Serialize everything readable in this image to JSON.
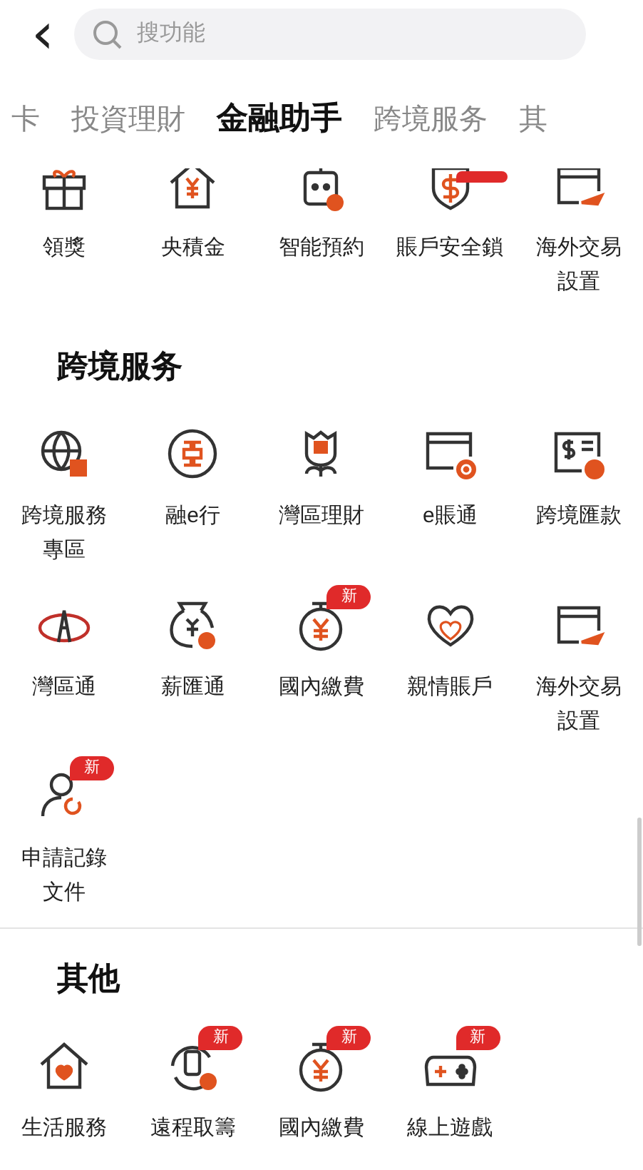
{
  "header": {
    "back": "‹",
    "search": {
      "placeholder": "搜功能"
    }
  },
  "tabs": [
    {
      "label": "卡",
      "selected": false
    },
    {
      "label": "投資理財",
      "selected": false
    },
    {
      "label": "金融助手",
      "selected": true
    },
    {
      "label": "跨境服务",
      "selected": false
    },
    {
      "label": "其",
      "selected": false
    }
  ],
  "sections": [
    {
      "items": [
        {
          "kind": "gift",
          "label": "領獎"
        },
        {
          "kind": "house-yen",
          "label": "央積金"
        },
        {
          "kind": "robot",
          "label": "智能預約"
        },
        {
          "kind": "shield",
          "label": "賬戶安全鎖",
          "flag": true
        },
        {
          "kind": "card-plane",
          "label": "海外交易設置"
        }
      ]
    },
    {
      "title": "跨境服务",
      "items": [
        {
          "kind": "globe",
          "label": "跨境服務專區"
        },
        {
          "kind": "coin",
          "label": "融e行"
        },
        {
          "kind": "flower",
          "label": "灣區理財"
        },
        {
          "kind": "card-e",
          "label": "e賬通"
        },
        {
          "kind": "cheque",
          "label": "跨境匯款"
        },
        {
          "kind": "ring",
          "label": "灣區通"
        },
        {
          "kind": "bag",
          "label": "薪匯通"
        },
        {
          "kind": "stopwatch",
          "label": "國內繳費",
          "badge": "新"
        },
        {
          "kind": "heart",
          "label": "親情賬戶"
        },
        {
          "kind": "card-plane",
          "label": "海外交易設置"
        },
        {
          "kind": "person",
          "label": "申請記錄文件",
          "badge": "新"
        }
      ]
    },
    {
      "title": "其他",
      "items": [
        {
          "kind": "house-heart",
          "label": "生活服務"
        },
        {
          "kind": "phone",
          "label": "遠程取籌",
          "badge": "新"
        },
        {
          "kind": "stopwatch",
          "label": "國內繳費",
          "badge": "新"
        },
        {
          "kind": "game",
          "label": "線上遊戲",
          "badge": "新"
        }
      ]
    }
  ]
}
